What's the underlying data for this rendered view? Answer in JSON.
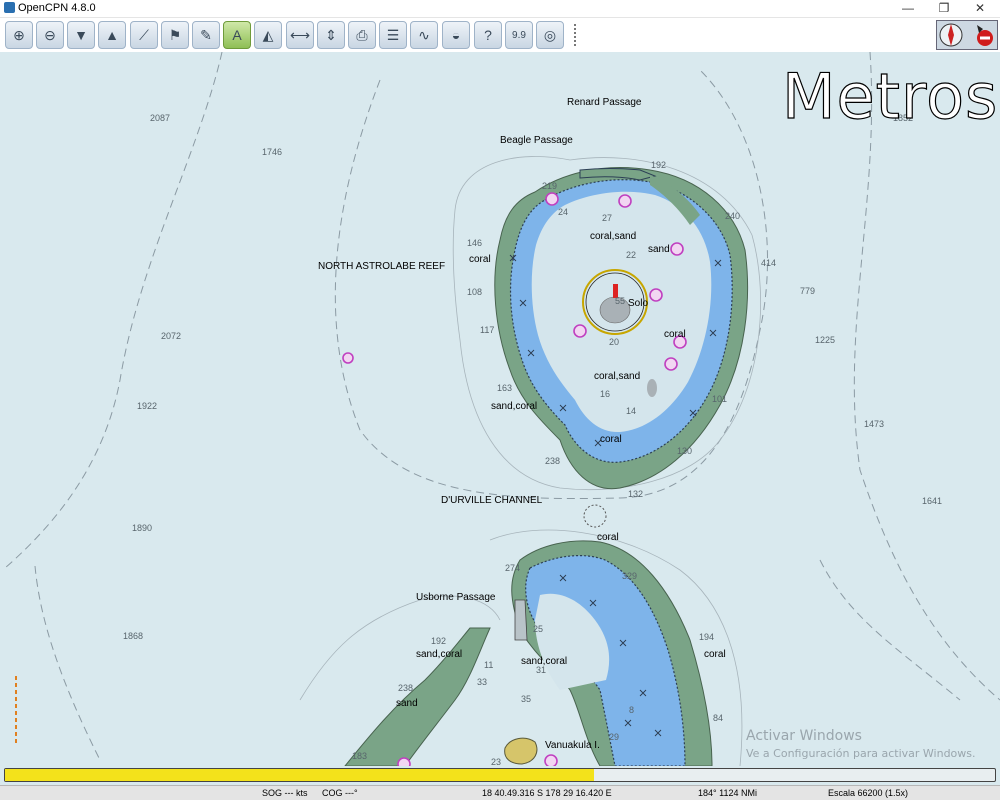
{
  "window": {
    "title": "OpenCPN 4.8.0",
    "minimize": "—",
    "restore": "❐",
    "close": "✕"
  },
  "toolbar": {
    "buttons": [
      {
        "name": "zoom-in-icon",
        "glyph": "⊕"
      },
      {
        "name": "zoom-out-icon",
        "glyph": "⊖"
      },
      {
        "name": "scale-in-icon",
        "glyph": "▼"
      },
      {
        "name": "scale-out-icon",
        "glyph": "▲"
      },
      {
        "name": "route-icon",
        "glyph": "⟋"
      },
      {
        "name": "mob-icon",
        "glyph": "⚑"
      },
      {
        "name": "tools-icon",
        "glyph": "✎"
      },
      {
        "name": "ais-icon",
        "glyph": "A"
      },
      {
        "name": "track-icon",
        "glyph": "◭"
      },
      {
        "name": "measure-icon",
        "glyph": "⟷"
      },
      {
        "name": "tide-icon",
        "glyph": "⇕"
      },
      {
        "name": "print-icon",
        "glyph": "⎙"
      },
      {
        "name": "route-manager-icon",
        "glyph": "☰"
      },
      {
        "name": "current-icon",
        "glyph": "∿"
      },
      {
        "name": "color-scheme-icon",
        "glyph": "◒"
      },
      {
        "name": "help-icon",
        "glyph": "?"
      },
      {
        "name": "version-icon",
        "glyph": "9.9"
      },
      {
        "name": "lifebuoy-icon",
        "glyph": "◎"
      }
    ]
  },
  "chart": {
    "scale_overlay": "Metros",
    "labels": {
      "renard": "Renard Passage",
      "beagle": "Beagle Passage",
      "north_reef": "NORTH ASTROLABE REEF",
      "durville": "D'URVILLE CHANNEL",
      "usborne": "Usborne Passage",
      "vanuakula": "Vanuakula I.",
      "solo": "Solo"
    },
    "bottom_texts": [
      "coral,sand",
      "sand",
      "coral",
      "coral",
      "coral,sand",
      "sand,coral",
      "coral",
      "coral",
      "sand,coral",
      "sand,coral",
      "sand",
      "coral"
    ],
    "depths": [
      "2087",
      "1746",
      "2072",
      "1922",
      "1890",
      "1868",
      "1852",
      "779",
      "1225",
      "1473",
      "1641",
      "414",
      "240",
      "192",
      "146",
      "108",
      "117",
      "163",
      "238",
      "130",
      "101",
      "132",
      "274",
      "329",
      "194",
      "192",
      "238",
      "183",
      "84",
      "27",
      "22",
      "20",
      "24",
      "219",
      "55",
      "25",
      "31",
      "33",
      "35",
      "29",
      "23",
      "11",
      "16",
      "14",
      "8"
    ]
  },
  "watermark": {
    "line1": "Activar Windows",
    "line2": "Ve a Configuración para activar Windows."
  },
  "progress": {
    "value": 0.595
  },
  "status": {
    "sog": "SOG --- kts",
    "cog": "COG ---°",
    "position": "18 40.49.316 S  178 29 16.420 E",
    "bearing": "184°  1124 NMi",
    "scale": "Escala 66200 (1.5x)"
  },
  "colors": {
    "sea": "#d9e9ee",
    "land": "#7aa487",
    "shallow": "#7eb4ea",
    "reef_fill": "#cfe0ea",
    "progress": "#f3e21b",
    "magenta": "#c040c0"
  }
}
